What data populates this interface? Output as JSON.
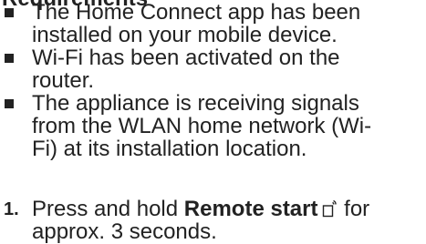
{
  "section": {
    "heading": "Requirements"
  },
  "requirements": [
    {
      "text": "The Home Connect app has been\ninstalled on your mobile device."
    },
    {
      "text": "Wi-Fi has been activated on the\nrouter."
    },
    {
      "text": "The appliance is receiving signals\nfrom the WLAN home network (Wi-\nFi) at its installation location."
    }
  ],
  "step": {
    "number": "1.",
    "text_before": "Press and hold ",
    "bold_text": "Remote start",
    "text_after_line1": " for",
    "text_line2": "approx. 3 seconds.",
    "icon": "remote-start-icon"
  }
}
